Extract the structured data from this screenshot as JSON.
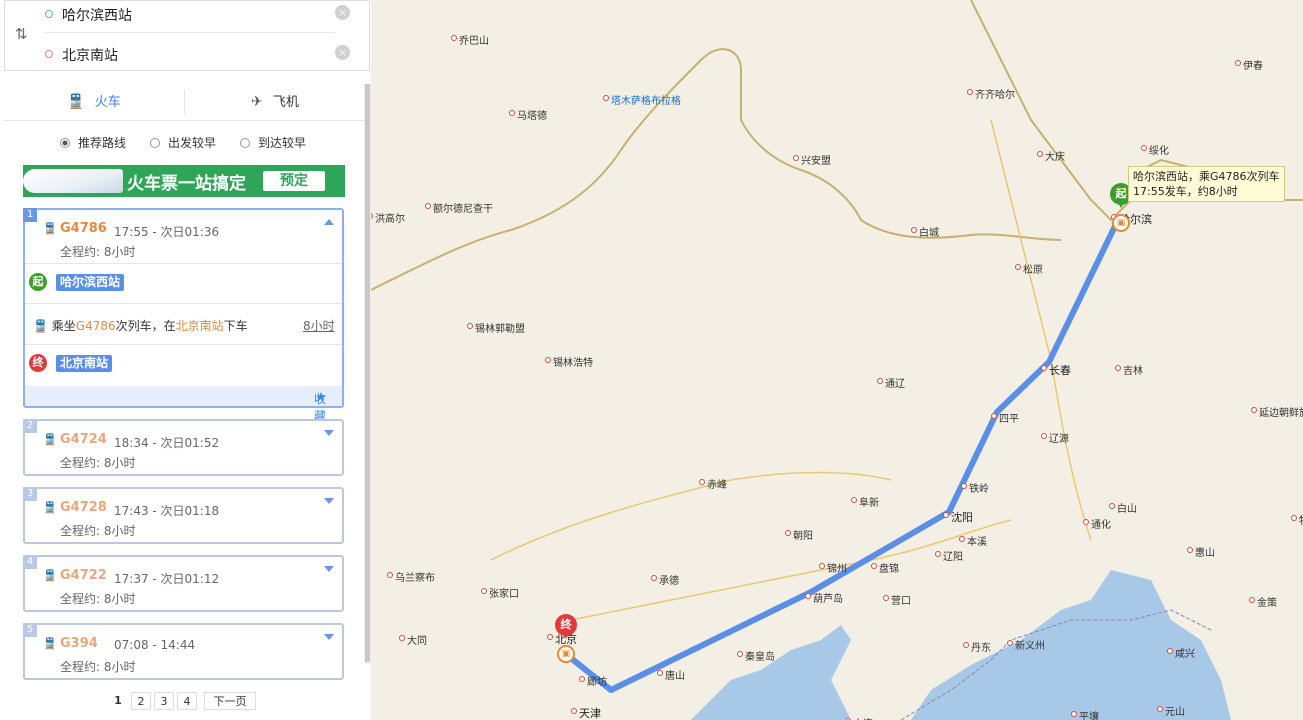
{
  "search": {
    "from": "哈尔滨西站",
    "to": "北京南站",
    "swap_icon": "swap-icon",
    "clear_icon": "⊗"
  },
  "tabs": [
    {
      "label": "火车",
      "icon": "train-icon",
      "active": true
    },
    {
      "label": "飞机",
      "icon": "plane-icon",
      "active": false
    }
  ],
  "sort_options": [
    {
      "label": "推荐路线",
      "selected": true
    },
    {
      "label": "出发较早",
      "selected": false
    },
    {
      "label": "到达较早",
      "selected": false
    }
  ],
  "banner": {
    "title": "火车票一站搞定",
    "button": "预定"
  },
  "routes": [
    {
      "index": "1",
      "train": "G4786",
      "time": "17:55 - 次日01:36",
      "duration": "全程约: 8小时",
      "expanded": true
    },
    {
      "index": "2",
      "train": "G4724",
      "time": "18:34 - 次日01:52",
      "duration": "全程约: 8小时",
      "expanded": false
    },
    {
      "index": "3",
      "train": "G4728",
      "time": "17:43 - 次日01:18",
      "duration": "全程约: 8小时",
      "expanded": false
    },
    {
      "index": "4",
      "train": "G4722",
      "time": "17:37 - 次日01:12",
      "duration": "全程约: 8小时",
      "expanded": false
    },
    {
      "index": "5",
      "train": "G394",
      "time": "07:08 - 14:44",
      "duration": "全程约: 8小时",
      "expanded": false
    }
  ],
  "detail": {
    "start_badge": "起",
    "start_station": "哈尔滨西站",
    "ride_prefix": "乘坐",
    "ride_train": "G4786",
    "ride_mid": "次列车，在",
    "ride_station": "北京南站",
    "ride_suffix": "下车",
    "ride_duration": "8小时",
    "end_badge": "终",
    "end_station": "北京南站",
    "favorite": "收藏"
  },
  "pager": {
    "pages": [
      "1",
      "2",
      "3",
      "4"
    ],
    "current": "1",
    "next": "下一页"
  },
  "map": {
    "tooltip": "哈尔滨西站，乘G4786次列车\n17:55发车，约8小时",
    "start_pin": "起",
    "end_pin": "终",
    "route_color": "#5b8ee6",
    "cities": [
      {
        "name": "乔巴山",
        "big": false
      },
      {
        "name": "塔木萨格布拉格",
        "big": false,
        "blue": true
      },
      {
        "name": "马塔德",
        "big": false
      },
      {
        "name": "伊春",
        "big": false
      },
      {
        "name": "齐齐哈尔",
        "big": false
      },
      {
        "name": "绥化",
        "big": false
      },
      {
        "name": "大庆",
        "big": false
      },
      {
        "name": "兴安盟",
        "big": false
      },
      {
        "name": "洪高尔",
        "big": false
      },
      {
        "name": "额尔德尼查干",
        "big": false
      },
      {
        "name": "白城",
        "big": false
      },
      {
        "name": "哈尔滨",
        "big": true
      },
      {
        "name": "松原",
        "big": false
      },
      {
        "name": "锡林郭勒盟",
        "big": false
      },
      {
        "name": "锡林浩特",
        "big": false
      },
      {
        "name": "长春",
        "big": true
      },
      {
        "name": "吉林",
        "big": false
      },
      {
        "name": "通辽",
        "big": false
      },
      {
        "name": "四平",
        "big": false
      },
      {
        "name": "辽源",
        "big": false
      },
      {
        "name": "延边朝鲜族自治州",
        "big": false
      },
      {
        "name": "赤峰",
        "big": false
      },
      {
        "name": "阜新",
        "big": false
      },
      {
        "name": "铁岭",
        "big": false
      },
      {
        "name": "白山",
        "big": false
      },
      {
        "name": "沈阳",
        "big": true
      },
      {
        "name": "朝阳",
        "big": false
      },
      {
        "name": "本溪",
        "big": false
      },
      {
        "name": "通化",
        "big": false
      },
      {
        "name": "辽阳",
        "big": false
      },
      {
        "name": "惠山",
        "big": false
      },
      {
        "name": "乌兰察布",
        "big": false
      },
      {
        "name": "承德",
        "big": false
      },
      {
        "name": "锦州",
        "big": false
      },
      {
        "name": "盘锦",
        "big": false
      },
      {
        "name": "张家口",
        "big": false
      },
      {
        "name": "葫芦岛",
        "big": false
      },
      {
        "name": "营口",
        "big": false
      },
      {
        "name": "金策",
        "big": false
      },
      {
        "name": "大同",
        "big": false
      },
      {
        "name": "北京",
        "big": true
      },
      {
        "name": "丹东",
        "big": false
      },
      {
        "name": "新义州",
        "big": false
      },
      {
        "name": "咸兴",
        "big": false
      },
      {
        "name": "秦皇岛",
        "big": false
      },
      {
        "name": "廊坊",
        "big": false
      },
      {
        "name": "唐山",
        "big": false
      },
      {
        "name": "天津",
        "big": true
      },
      {
        "name": "平壤",
        "big": false
      },
      {
        "name": "元山",
        "big": false
      },
      {
        "name": "牡",
        "big": false
      },
      {
        "name": "大连",
        "big": false
      }
    ]
  }
}
